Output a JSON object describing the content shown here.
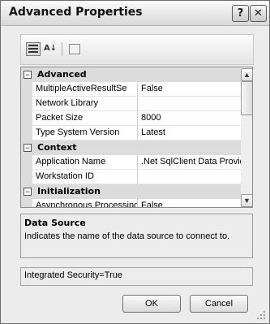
{
  "window": {
    "title": "Advanced Properties"
  },
  "titlebar": {
    "help_glyph": "?",
    "close_glyph": "✕"
  },
  "toolbar": {
    "categorized_icon": "categorized-icon",
    "alphabetical_glyph": "A↓",
    "property_pages_icon": "property-pages-icon"
  },
  "grid": {
    "categories": [
      {
        "label": "Advanced",
        "toggle": "⊟",
        "rows": [
          {
            "name": "MultipleActiveResultSe",
            "value": "False"
          },
          {
            "name": "Network Library",
            "value": ""
          },
          {
            "name": "Packet Size",
            "value": "8000"
          },
          {
            "name": "Type System Version",
            "value": "Latest"
          }
        ]
      },
      {
        "label": "Context",
        "toggle": "⊟",
        "rows": [
          {
            "name": "Application Name",
            "value": ".Net SqlClient Data Provid"
          },
          {
            "name": "Workstation ID",
            "value": ""
          }
        ]
      },
      {
        "label": "Initialization",
        "toggle": "⊟",
        "rows": [
          {
            "name": "Asynchronous Processing",
            "value": "False"
          }
        ]
      }
    ],
    "scroll_up_glyph": "▲",
    "scroll_down_glyph": "▼"
  },
  "description": {
    "title": "Data Source",
    "text": "Indicates the name of the data source to connect to."
  },
  "connection_string": "Integrated Security=True",
  "buttons": {
    "ok": "OK",
    "cancel": "Cancel"
  }
}
